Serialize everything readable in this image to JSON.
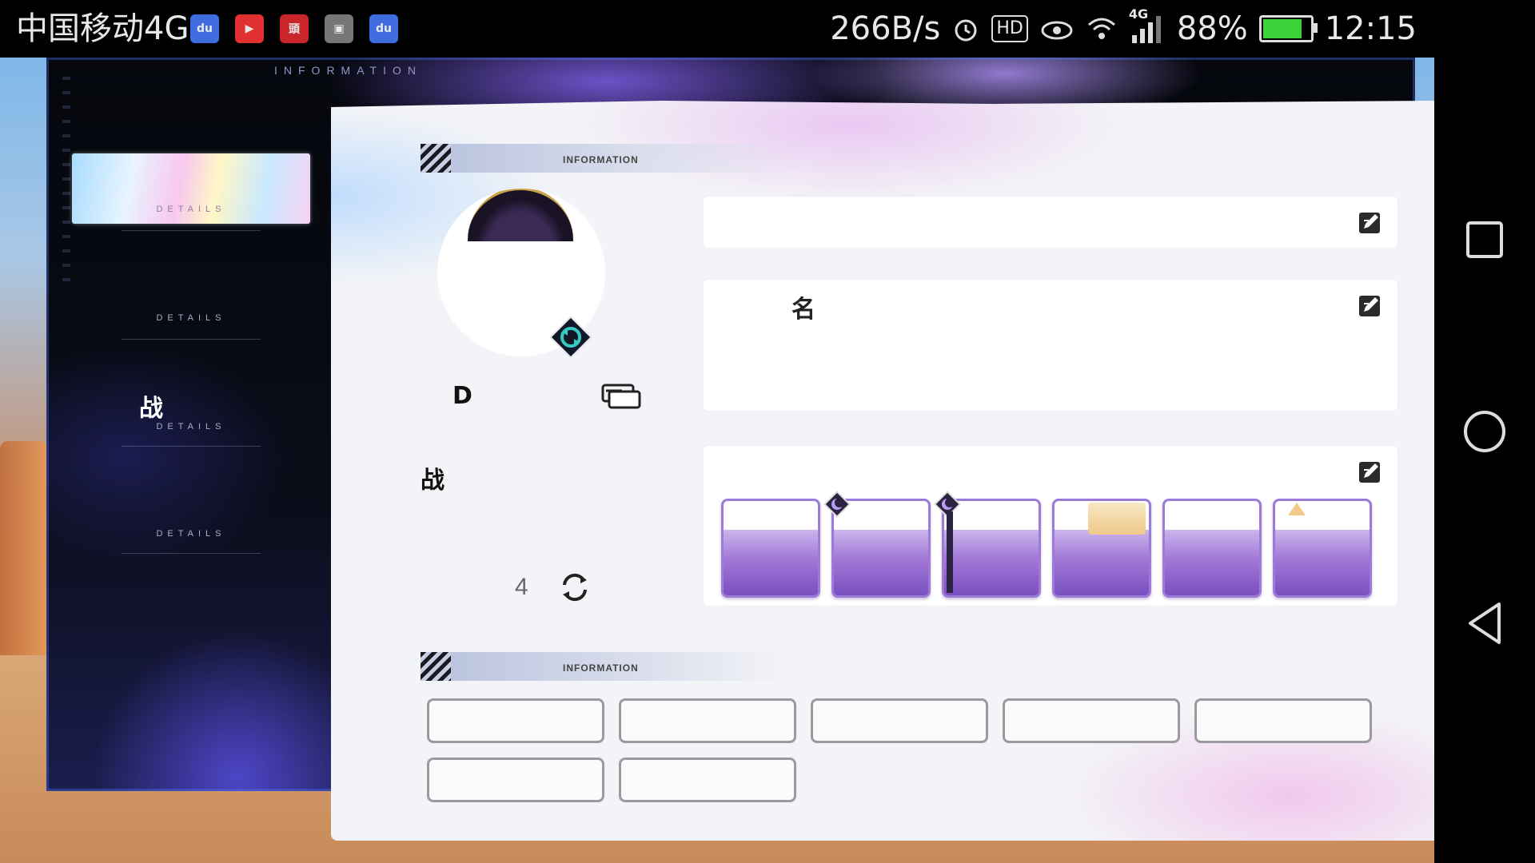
{
  "status_bar": {
    "carrier": "中国移动4G",
    "apps": [
      {
        "name": "baidu-icon",
        "label": "du",
        "color": "#3f6de0"
      },
      {
        "name": "video-icon",
        "label": "▶",
        "color": "#e03030"
      },
      {
        "name": "news-icon",
        "label": "頭",
        "color": "#c8262b"
      },
      {
        "name": "gallery-icon",
        "label": "▣",
        "color": "#777777"
      },
      {
        "name": "baidu-icon-2",
        "label": "du",
        "color": "#3f6de0"
      }
    ],
    "net_speed": "266B/s",
    "hd_label": "HD",
    "network_label": "4G",
    "battery": "88%",
    "battery_level": 0.88,
    "time": "12:15"
  },
  "left_panel": {
    "title": "INFORMATION",
    "menu": [
      {
        "sub": "DETAILS",
        "label": "",
        "active": true
      },
      {
        "sub": "DETAILS",
        "label": "",
        "active": false
      },
      {
        "sub": "DETAILS",
        "label": "战",
        "active": false
      },
      {
        "sub": "DETAILS",
        "label": "",
        "active": false
      }
    ]
  },
  "card": {
    "section1_title": "INFORMATION",
    "section2_title": "INFORMATION",
    "stat_left": "D",
    "battle_label": "战",
    "count": "4",
    "name_field_glyph": "名"
  },
  "colors": {
    "accent_purple": "#9b7ad8",
    "badge_teal": "#36c9c4"
  }
}
